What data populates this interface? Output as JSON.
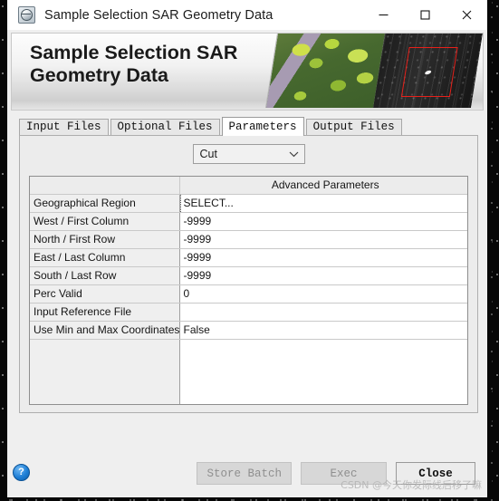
{
  "window": {
    "title": "Sample Selection SAR Geometry Data",
    "icon": "globe-icon",
    "controls": {
      "minimize": "Minimize",
      "maximize": "Maximize",
      "close": "Close"
    }
  },
  "banner": {
    "title_line1": "Sample Selection SAR",
    "title_line2": "Geometry Data",
    "optical_image": "optical-thumbnail",
    "sar_image": "sar-thumbnail"
  },
  "tabs": [
    {
      "label": "Input Files",
      "selected": false
    },
    {
      "label": "Optional Files",
      "selected": false
    },
    {
      "label": "Parameters",
      "selected": true
    },
    {
      "label": "Output Files",
      "selected": false
    }
  ],
  "panel": {
    "mode_select": {
      "value": "Cut",
      "arrow": "chevron-down-icon"
    },
    "table": {
      "header_left": "",
      "header_main": "Advanced Parameters",
      "rows": [
        {
          "key": "Geographical Region",
          "value": "SELECT...",
          "focused": true
        },
        {
          "key": "West / First Column",
          "value": "-9999",
          "focused": false
        },
        {
          "key": "North / First Row",
          "value": "-9999",
          "focused": false
        },
        {
          "key": "East / Last Column",
          "value": "-9999",
          "focused": false
        },
        {
          "key": "South / Last Row",
          "value": "-9999",
          "focused": false
        },
        {
          "key": "Perc Valid",
          "value": "0",
          "focused": false
        },
        {
          "key": "Input Reference File",
          "value": "",
          "focused": false
        },
        {
          "key": "Use Min and Max Coordinates",
          "value": "False",
          "focused": false
        }
      ]
    }
  },
  "footer": {
    "help": "?",
    "store_batch": "Store Batch",
    "exec": "Exec",
    "close": "Close",
    "watermark": "CSDN @今天你发际线后移了嘛"
  }
}
